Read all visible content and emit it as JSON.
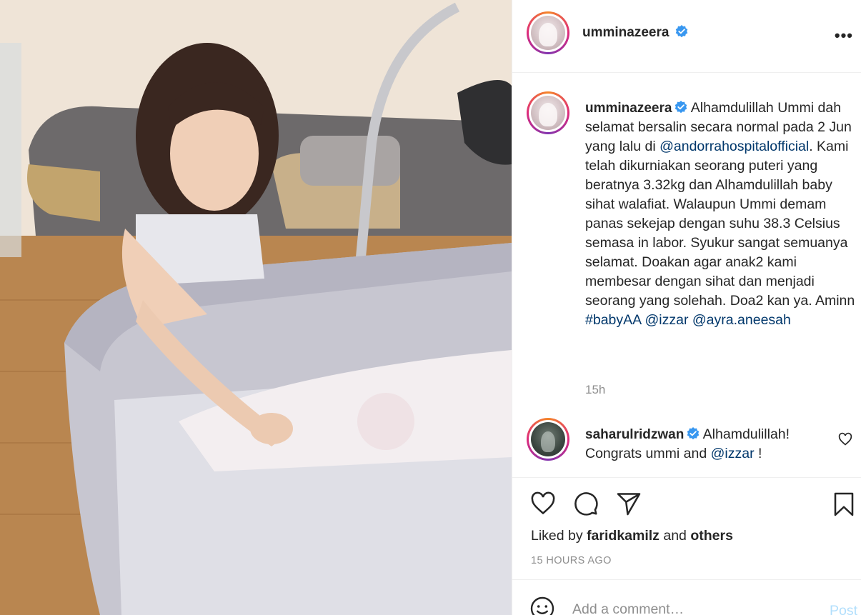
{
  "post": {
    "author": "umminazeera",
    "author_verified": true,
    "more_icon": "more-horizontal-icon",
    "caption": {
      "username": "umminazeera",
      "text_before_mention": "Alhamdulillah Ummi dah selamat bersalin secara normal pada 2 Jun yang lalu di",
      "mention1": "@andorrahospitalofficial",
      "text_middle": ". Kami telah dikurniakan seorang puteri yang beratnya 3.32kg dan Alhamdulillah baby sihat walafiat. Walaupun Ummi demam panas sekejap dengan suhu 38.3 Celsius semasa in labor. Syukur sangat semuanya selamat. Doakan agar anak2 kami membesar dengan sihat dan menjadi seorang yang solehah. Doa2 kan ya. Aminn",
      "hashtag": "#babyAA",
      "mention2": "@izzar",
      "mention3": "@ayra.aneesah",
      "age": "15h"
    },
    "comment": {
      "username": "saharulridzwan",
      "text_before": "Alhamdulillah! Congrats ummi and",
      "mention": "@izzar",
      "text_after": " !"
    },
    "likes": {
      "prefix": "Liked by",
      "user": "faridkamilz",
      "conjunction": "and",
      "others": "others"
    },
    "timestamp": "15 HOURS AGO",
    "add_comment": {
      "placeholder": "Add a comment…",
      "post_label": "Post"
    }
  },
  "colors": {
    "link": "#00376b",
    "verified": "#3897f0",
    "muted": "#8e8e8e",
    "post_disabled": "#b2dffc"
  },
  "icons": [
    "heart-icon",
    "comment-icon",
    "share-icon",
    "bookmark-icon",
    "emoji-icon",
    "verified-badge-icon"
  ]
}
